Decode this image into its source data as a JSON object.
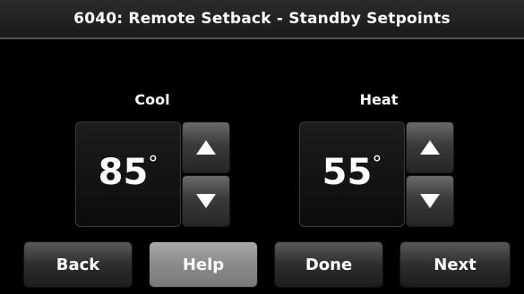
{
  "title": "6040: Remote Setback - Standby Setpoints",
  "cool": {
    "label": "Cool",
    "value": "85",
    "unit": "°"
  },
  "heat": {
    "label": "Heat",
    "value": "55",
    "unit": "°"
  },
  "buttons": {
    "back": "Back",
    "help": "Help",
    "done": "Done",
    "next": "Next"
  },
  "icons": {
    "up": "up-arrow-icon",
    "down": "down-arrow-icon"
  }
}
